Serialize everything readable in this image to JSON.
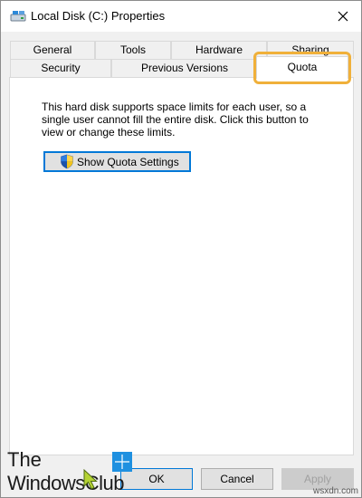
{
  "window": {
    "title": "Local Disk (C:) Properties",
    "close_glyph": "✕"
  },
  "tabs": {
    "row1": [
      "General",
      "Tools",
      "Hardware",
      "Sharing"
    ],
    "row2": [
      "Security",
      "Previous Versions",
      "Quota"
    ],
    "active": "Quota"
  },
  "quota": {
    "description": "This hard disk supports space limits for each user, so a single user cannot fill the entire disk. Click this button to view or change these limits.",
    "button_label": "Show Quota Settings"
  },
  "footer": {
    "ok_label": "OK",
    "cancel_label": "Cancel",
    "apply_label": "Apply"
  },
  "logo": {
    "line1": "The",
    "line2": "WindowsClub"
  },
  "watermark": "wsxdn.com",
  "colors": {
    "highlight": "#f0b03a",
    "focus_blue": "#0078d7",
    "disabled_text": "#a0a0a0"
  }
}
